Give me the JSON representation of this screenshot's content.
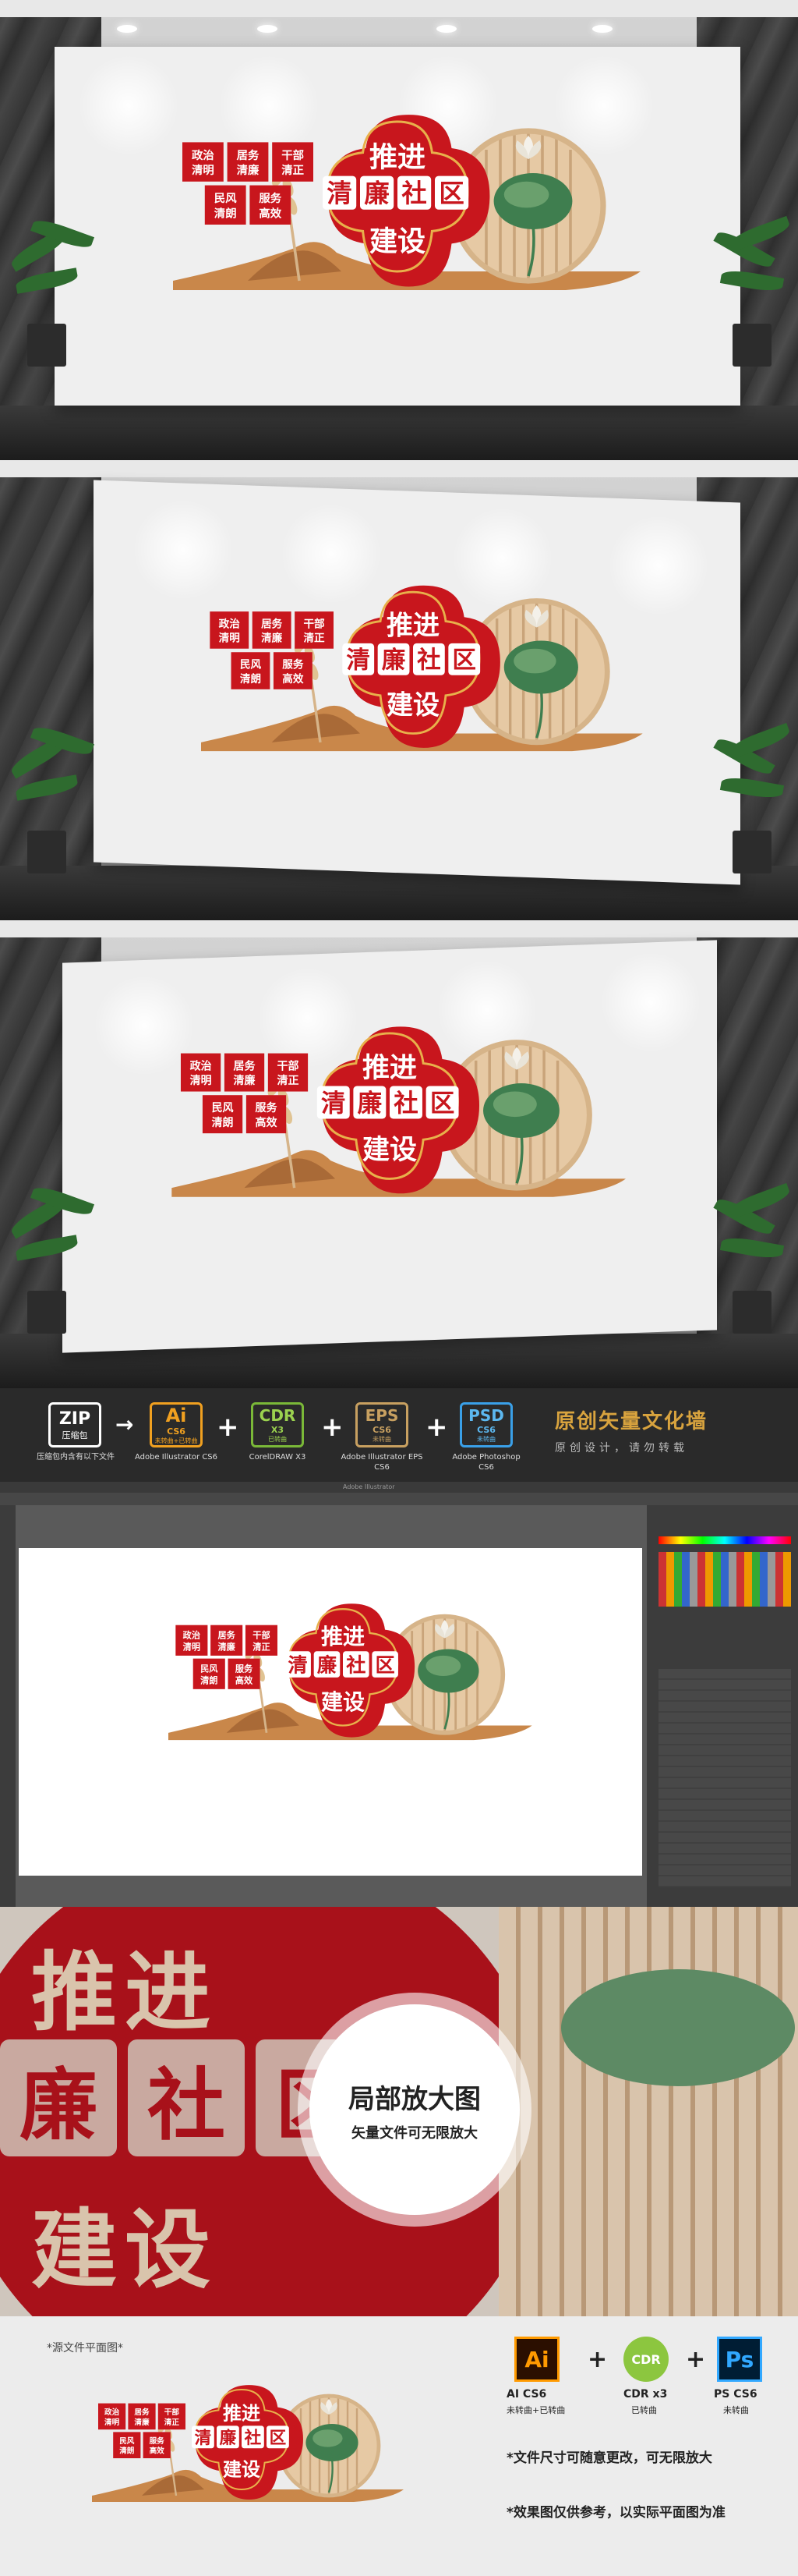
{
  "artwork": {
    "main_top": "推进",
    "main_chars": [
      "清",
      "廉",
      "社",
      "区"
    ],
    "main_bottom": "建设",
    "tags": [
      "政治清明",
      "居务清廉",
      "干部清正",
      "民风清朗",
      "服务高效"
    ]
  },
  "toolbar": {
    "zip": {
      "icon": "ZIP",
      "label": "压缩包",
      "caption": "压缩包内含有以下文件"
    },
    "ai": {
      "icon": "Ai",
      "version": "CS6",
      "note": "未转曲+已转曲",
      "caption": "Adobe Illustrator CS6"
    },
    "cdr": {
      "icon": "CDR",
      "version": "X3",
      "note": "已转曲",
      "caption": "CorelDRAW X3"
    },
    "eps": {
      "icon": "EPS",
      "version": "CS6",
      "note": "未转曲",
      "caption": "Adobe Illustrator EPS CS6"
    },
    "psd": {
      "icon": "PSD",
      "version": "CS6",
      "note": "未转曲",
      "caption": "Adobe Photoshop CS6"
    },
    "headline": "原创矢量文化墙",
    "subline": "原创设计，请勿转载"
  },
  "software": {
    "window_title": "Adobe Illustrator"
  },
  "zoom": {
    "title": "局部放大图",
    "subtitle": "矢量文件可无限放大"
  },
  "bottom": {
    "label": "*源文件平面图*",
    "formats": [
      {
        "icon": "Ai",
        "name": "AI CS6",
        "note": "未转曲+已转曲"
      },
      {
        "icon": "CDR",
        "name": "CDR x3",
        "note": "已转曲"
      },
      {
        "icon": "Ps",
        "name": "PS CS6",
        "note": "未转曲"
      }
    ],
    "notes": [
      "*文件尺寸可随意更改，可无限放大",
      "*效果图仅供参考，以实际平面图为准"
    ]
  },
  "colors": {
    "red": "#c8161d",
    "gold": "#e8b04b",
    "wood": "#e6c9a4",
    "tan": "#c9874a",
    "leaf": "#3f7e4f",
    "panel": "#2a2a2a"
  }
}
